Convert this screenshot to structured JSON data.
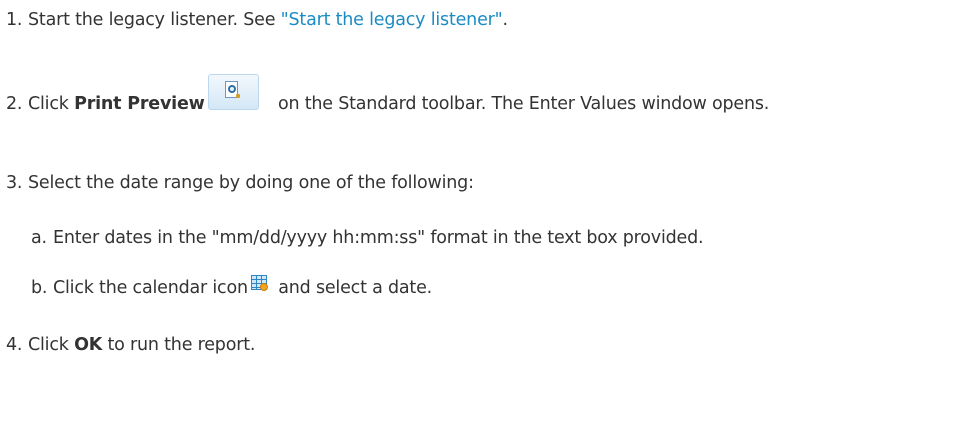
{
  "steps": {
    "step1": {
      "number": "1.",
      "text_before": "Start the legacy listener. See ",
      "link_text": "\"Start the legacy listener\"",
      "text_after": "."
    },
    "step2": {
      "number": "2.",
      "text_before": "Click ",
      "bold_text": "Print Preview",
      "icon": "print-preview-icon",
      "text_after": " on the Standard toolbar. The Enter Values window opens."
    },
    "step3": {
      "number": "3.",
      "text": "Select the date range by doing one of the following:",
      "substeps": {
        "a": {
          "letter": "a.",
          "text": "Enter dates in the \"mm/dd/yyyy hh:mm:ss\" format in the text box provided."
        },
        "b": {
          "letter": "b.",
          "text_before": "Click the calendar icon",
          "icon": "calendar-icon",
          "text_after": " and select a date."
        }
      }
    },
    "step4": {
      "number": "4.",
      "text_before": "Click ",
      "bold_text": "OK",
      "text_after": " to run the report."
    }
  },
  "colors": {
    "text": "#333333",
    "link": "#1a8bc4",
    "background": "#ffffff"
  }
}
